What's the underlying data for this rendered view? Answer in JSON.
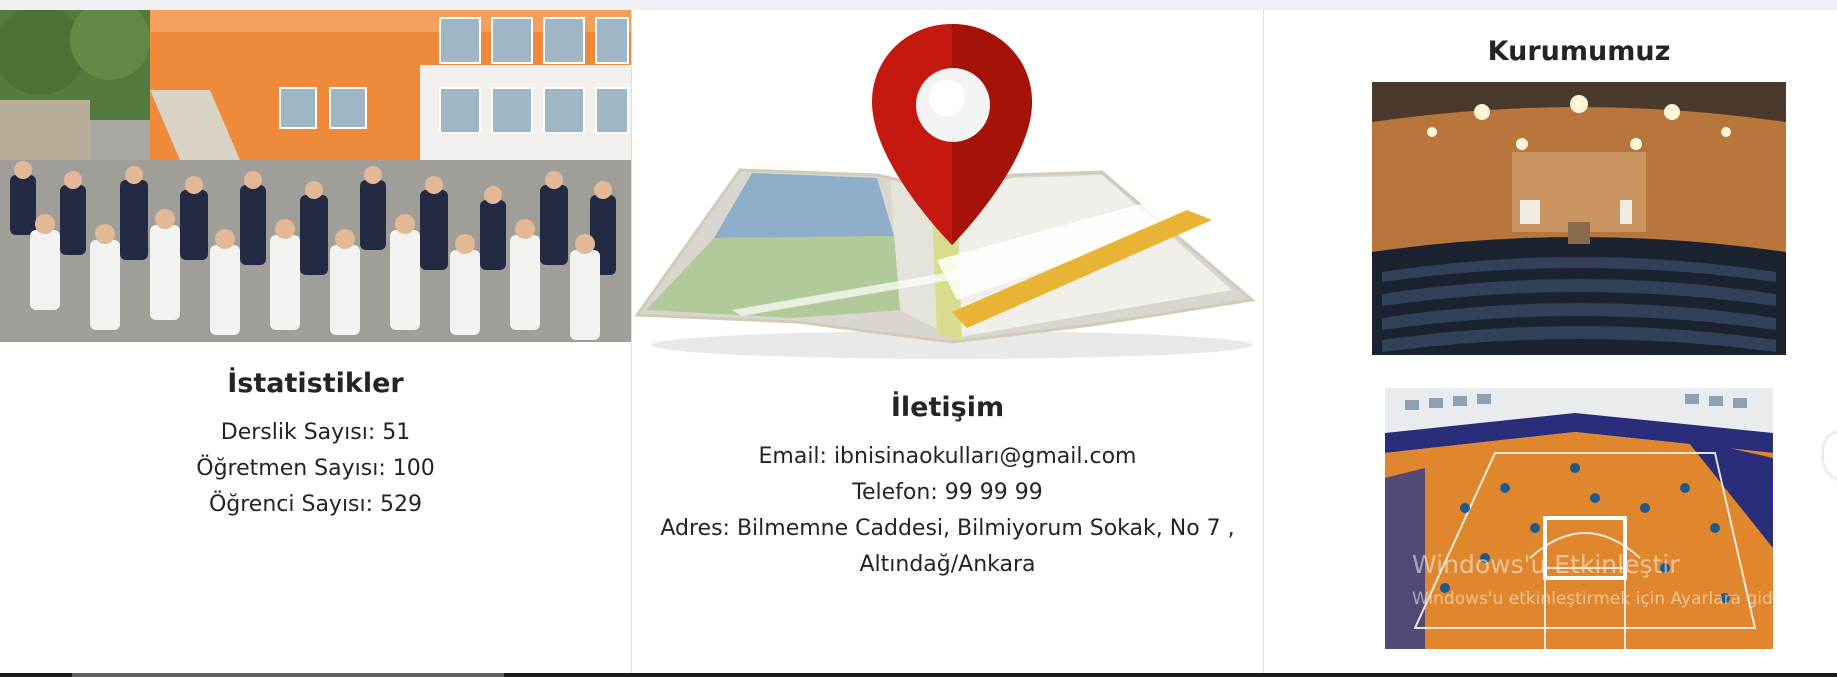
{
  "stats": {
    "title": "İstatistikler",
    "lines": [
      "Derslik Sayısı: 51",
      "Öğretmen Sayısı: 100",
      "Öğrenci Sayısı: 529"
    ]
  },
  "contact": {
    "title": "İletişim",
    "lines": [
      "Email: ibnisinaokulları@gmail.com",
      "Telefon: 99 99 99",
      "Adres: Bilmemne Caddesi, Bilmiyorum Sokak, No 7 ,",
      "Altındağ/Ankara"
    ]
  },
  "institution": {
    "title": "Kurumumuz"
  },
  "watermark": {
    "title": "Windows'u Etkinleştir",
    "subtitle": "Windows'u etkinleştirmek için Ayarlara gidin."
  },
  "colors": {
    "pin": "#c41810",
    "floor": "#e0862c",
    "hall_wall": "#b8753c",
    "school_wall": "#ef8a3a"
  }
}
